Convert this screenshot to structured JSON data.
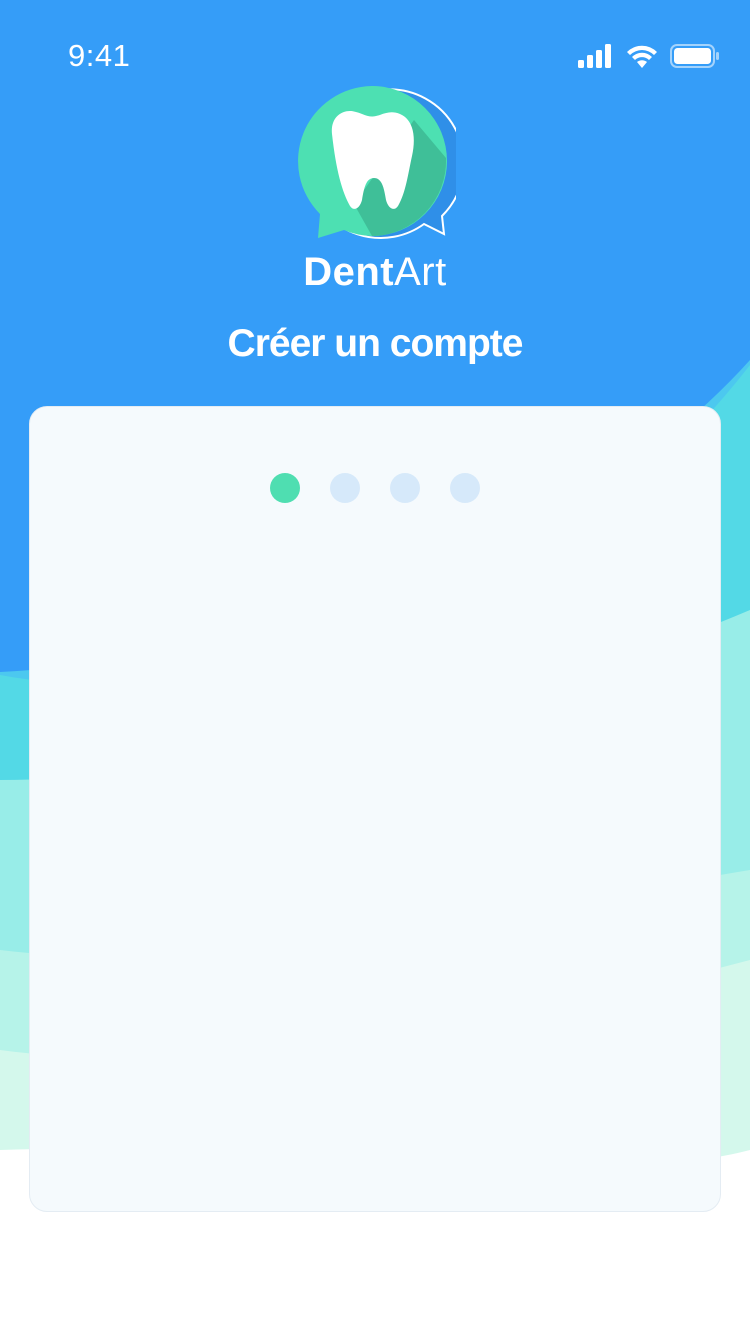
{
  "status_bar": {
    "time": "9:41",
    "icons": [
      "signal-icon",
      "wifi-icon",
      "battery-icon"
    ]
  },
  "app": {
    "brand_bold": "Dent",
    "brand_light": "Art",
    "logo_icon": "tooth-chat-bubble-icon"
  },
  "screen": {
    "title": "Créer un compte"
  },
  "stepper": {
    "total_steps": 4,
    "current_step": 1
  },
  "colors": {
    "primary_blue": "#349DF8",
    "accent_green": "#4FDEB1",
    "card_bg": "#F5FAFD",
    "inactive_dot": "#D6E9FA"
  }
}
